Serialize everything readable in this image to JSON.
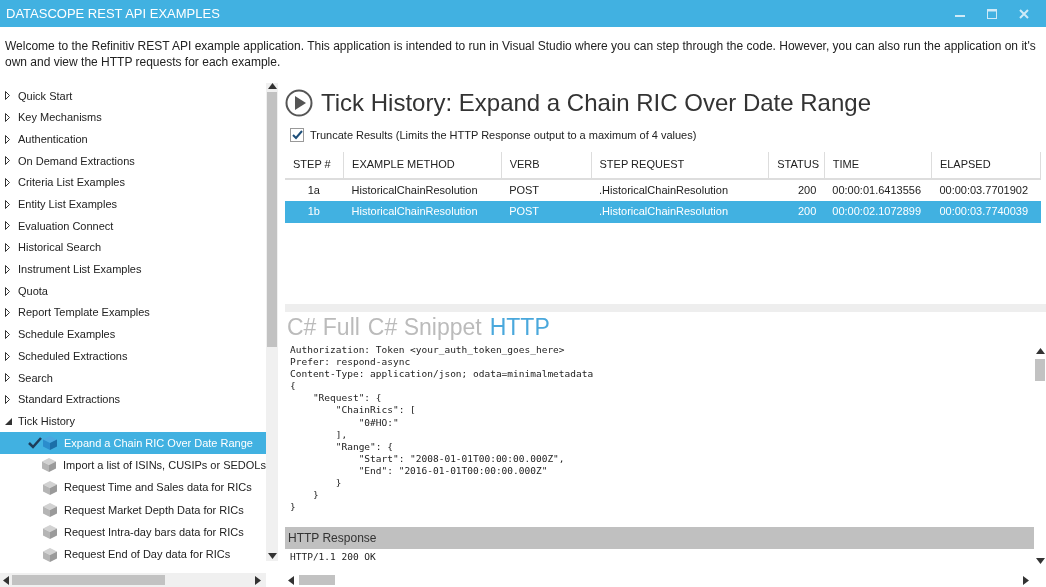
{
  "window": {
    "title": "DATASCOPE REST API EXAMPLES"
  },
  "intro": "Welcome to the Refinitiv REST API example application.  This application is intended to run in Visual Studio where you can step through the code.  However, you can also run the application on it's own and view the HTTP requests for each example.",
  "tree": [
    {
      "label": "Quick Start",
      "expanded": false
    },
    {
      "label": "Key Mechanisms",
      "expanded": false
    },
    {
      "label": "Authentication",
      "expanded": false
    },
    {
      "label": "On Demand Extractions",
      "expanded": false
    },
    {
      "label": "Criteria List Examples",
      "expanded": false
    },
    {
      "label": "Entity List Examples",
      "expanded": false
    },
    {
      "label": "Evaluation Connect",
      "expanded": false
    },
    {
      "label": "Historical Search",
      "expanded": false
    },
    {
      "label": "Instrument List Examples",
      "expanded": false
    },
    {
      "label": "Quota",
      "expanded": false
    },
    {
      "label": "Report Template Examples",
      "expanded": false
    },
    {
      "label": "Schedule Examples",
      "expanded": false
    },
    {
      "label": "Scheduled Extractions",
      "expanded": false
    },
    {
      "label": "Search",
      "expanded": false
    },
    {
      "label": "Standard Extractions",
      "expanded": false
    },
    {
      "label": "Tick History",
      "expanded": true,
      "children": [
        {
          "label": "Expand a Chain RIC Over Date Range",
          "selected": true,
          "completed": true
        },
        {
          "label": "Import a list of ISINs, CUSIPs or SEDOLs",
          "selected": false,
          "completed": false
        },
        {
          "label": "Request Time and Sales data for RICs",
          "selected": false,
          "completed": false
        },
        {
          "label": "Request Market Depth Data for RICs",
          "selected": false,
          "completed": false
        },
        {
          "label": "Request Intra-day bars data for RICs",
          "selected": false,
          "completed": false
        },
        {
          "label": "Request End of Day data for RICs",
          "selected": false,
          "completed": false
        }
      ]
    }
  ],
  "example": {
    "title": "Tick History: Expand a Chain RIC Over Date Range",
    "truncate": {
      "label": "Truncate Results (Limits the HTTP Response output to a maximum of 4 values)",
      "checked": true
    }
  },
  "table": {
    "columns": [
      "STEP #",
      "EXAMPLE METHOD",
      "VERB",
      "STEP REQUEST",
      "STATUS",
      "TIME",
      "ELAPSED"
    ],
    "rows": [
      {
        "selected": false,
        "cells": [
          "1a",
          "HistoricalChainResolution",
          "POST",
          ".HistoricalChainResolution",
          "200",
          "00:00:01.6413556",
          "00:00:03.7701902"
        ]
      },
      {
        "selected": true,
        "cells": [
          "1b",
          "HistoricalChainResolution",
          "POST",
          ".HistoricalChainResolution",
          "200",
          "00:00:02.1072899",
          "00:00:03.7740039"
        ]
      }
    ]
  },
  "code_tabs": [
    {
      "label": "C# Full",
      "selected": false
    },
    {
      "label": "C# Snippet",
      "selected": false
    },
    {
      "label": "HTTP",
      "selected": true
    }
  ],
  "request_lines": [
    "Authorization: Token <your_auth_token_goes_here>",
    "Prefer: respond-async",
    "Content-Type: application/json; odata=minimalmetadata",
    "{",
    "    \"Request\": {",
    "        \"ChainRics\": [",
    "            \"0#HO:\"",
    "        ],",
    "        \"Range\": {",
    "            \"Start\": \"2008-01-01T00:00:00.000Z\",",
    "            \"End\": \"2016-01-01T00:00:00.000Z\"",
    "        }",
    "    }",
    "}"
  ],
  "response": {
    "title": "HTTP Response",
    "lines": [
      "HTTP/1.1 200 OK"
    ]
  }
}
